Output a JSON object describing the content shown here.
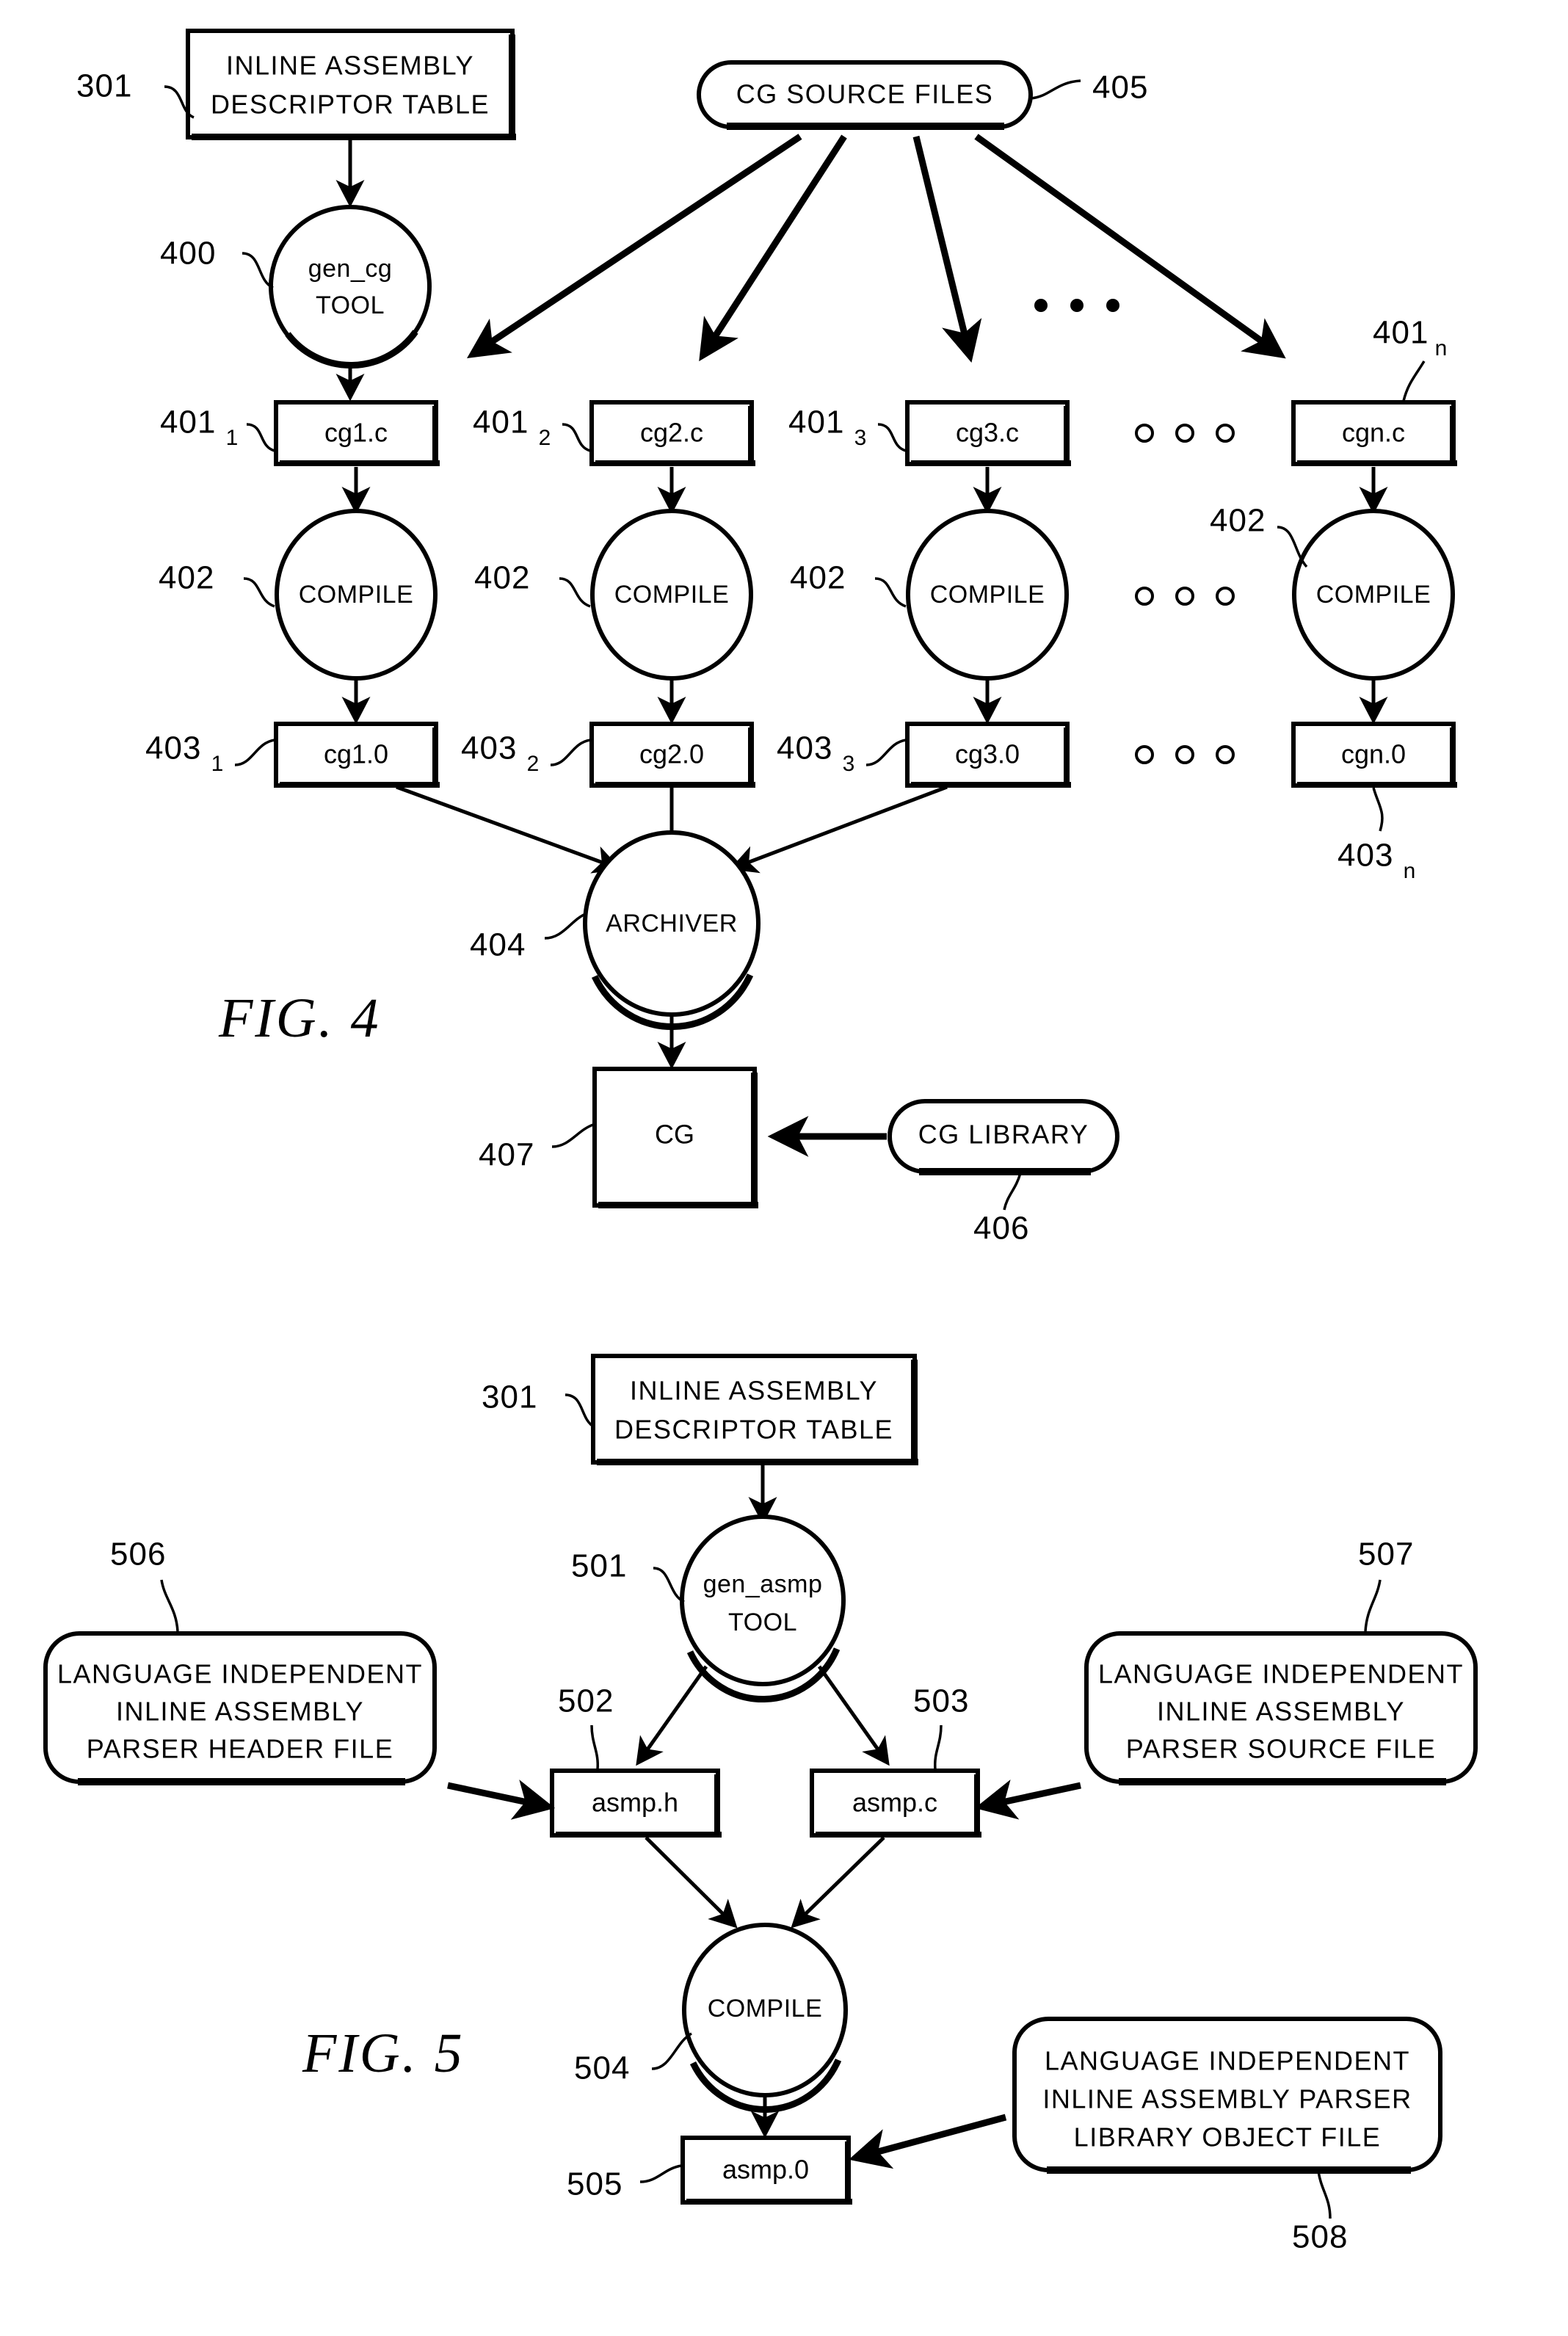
{
  "figures": [
    {
      "id": "fig4",
      "title": "FIG.  4",
      "nodes": {
        "descriptor_table": {
          "line1": "INLINE ASSEMBLY",
          "line2": "DESCRIPTOR TABLE",
          "ref": "301"
        },
        "cg_source_files": {
          "label": "CG SOURCE FILES",
          "ref": "405"
        },
        "gen_cg_tool": {
          "line1": "gen_cg",
          "line2": "TOOL",
          "ref": "400"
        },
        "archiver": {
          "label": "ARCHIVER",
          "ref": "404"
        },
        "cg_output": {
          "label": "CG",
          "ref": "407"
        },
        "cg_library": {
          "label": "CG LIBRARY",
          "ref": "406"
        }
      },
      "source_files": [
        {
          "label": "cg1.c",
          "ref": "401",
          "sub": "1"
        },
        {
          "label": "cg2.c",
          "ref": "401",
          "sub": "2"
        },
        {
          "label": "cg3.c",
          "ref": "401",
          "sub": "3"
        },
        {
          "label": "cgn.c",
          "ref": "401",
          "sub": "n"
        }
      ],
      "compile_nodes": [
        {
          "label": "COMPILE",
          "ref": "402"
        },
        {
          "label": "COMPILE",
          "ref": "402"
        },
        {
          "label": "COMPILE",
          "ref": "402"
        },
        {
          "label": "COMPILE",
          "ref": "402"
        }
      ],
      "object_files": [
        {
          "label": "cg1.0",
          "ref": "403",
          "sub": "1"
        },
        {
          "label": "cg2.0",
          "ref": "403",
          "sub": "2"
        },
        {
          "label": "cg3.0",
          "ref": "403",
          "sub": "3"
        },
        {
          "label": "cgn.0",
          "ref": "403",
          "sub": "n"
        }
      ],
      "ellipsis": [
        "•",
        "•",
        "•"
      ]
    },
    {
      "id": "fig5",
      "title": "FIG.  5",
      "nodes": {
        "descriptor_table": {
          "line1": "INLINE ASSEMBLY",
          "line2": "DESCRIPTOR TABLE",
          "ref": "301"
        },
        "gen_asmp_tool": {
          "line1": "gen_asmp",
          "line2": "TOOL",
          "ref": "501"
        },
        "asmp_h": {
          "label": "asmp.h",
          "ref": "502"
        },
        "asmp_c": {
          "label": "asmp.c",
          "ref": "503"
        },
        "compile": {
          "label": "COMPILE",
          "ref": "504"
        },
        "asmp_o": {
          "label": "asmp.0",
          "ref": "505"
        },
        "parser_header_file": {
          "line1": "LANGUAGE INDEPENDENT",
          "line2": "INLINE ASSEMBLY",
          "line3": "PARSER HEADER FILE",
          "ref": "506"
        },
        "parser_source_file": {
          "line1": "LANGUAGE INDEPENDENT",
          "line2": "INLINE ASSEMBLY",
          "line3": "PARSER SOURCE FILE",
          "ref": "507"
        },
        "parser_library_object_file": {
          "line1": "LANGUAGE INDEPENDENT",
          "line2": "INLINE ASSEMBLY PARSER",
          "line3": "LIBRARY OBJECT FILE",
          "ref": "508"
        }
      }
    }
  ],
  "colors": {
    "ink": "#000000",
    "paper": "#ffffff"
  }
}
